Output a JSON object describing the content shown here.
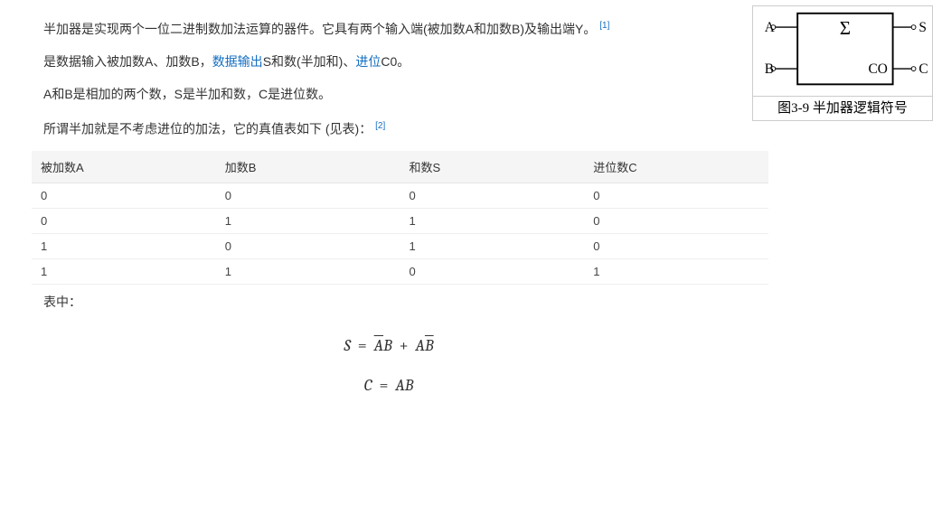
{
  "paragraphs": {
    "p1_a": "半加器是实现两个一位二进制数加法运算的器件。它具有两个输入端(被加数A和加数B)及输出端Y。",
    "ref1": "[1]",
    "p2_a": "是数据输入被加数A、加数B，",
    "p2_link1": "数据输出",
    "p2_b": "S和数(半加和)、",
    "p2_link2": "进位",
    "p2_c": "C0。",
    "p3": "A和B是相加的两个数，S是半加和数，C是进位数。",
    "p4": "所谓半加就是不考虑进位的加法，它的真值表如下 (见表)：",
    "ref2": "[2]",
    "after_table": "表中："
  },
  "figure": {
    "diagram": {
      "sigma": "Σ",
      "A": "A",
      "B": "B",
      "S": "S",
      "CO": "CO",
      "C": "C"
    },
    "caption": "图3-9 半加器逻辑符号"
  },
  "table": {
    "headers": [
      "被加数A",
      "加数B",
      "和数S",
      "进位数C"
    ],
    "rows": [
      [
        "0",
        "0",
        "0",
        "0"
      ],
      [
        "0",
        "1",
        "1",
        "0"
      ],
      [
        "1",
        "0",
        "1",
        "0"
      ],
      [
        "1",
        "1",
        "0",
        "1"
      ]
    ]
  },
  "formulas": {
    "f1": {
      "lhs": "S",
      "eq": "=",
      "Abar": "A",
      "B1": "B",
      "plus": "+",
      "A2": "A",
      "Bbar": "B"
    },
    "f2": {
      "lhs": "C",
      "eq": "=",
      "rhs": "AB"
    }
  }
}
